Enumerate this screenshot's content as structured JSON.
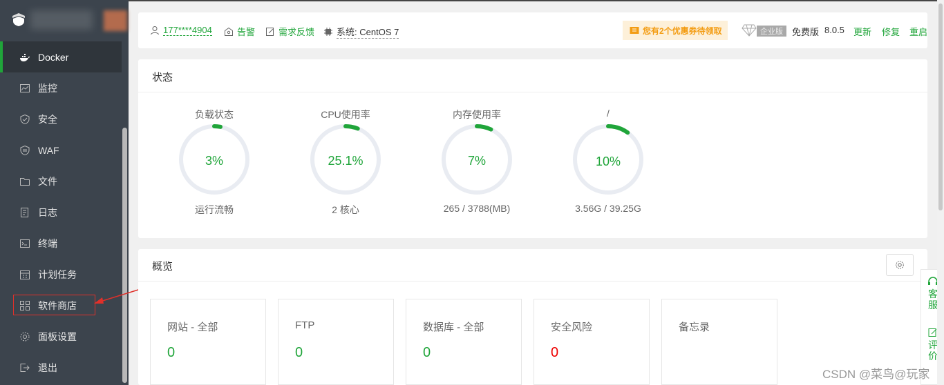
{
  "sidebar": {
    "items": [
      {
        "label": "Docker",
        "icon": "docker-icon",
        "active": true
      },
      {
        "label": "监控",
        "icon": "monitor-icon"
      },
      {
        "label": "安全",
        "icon": "shield-icon"
      },
      {
        "label": "WAF",
        "icon": "waf-shield-icon"
      },
      {
        "label": "文件",
        "icon": "folder-icon"
      },
      {
        "label": "日志",
        "icon": "log-icon"
      },
      {
        "label": "终端",
        "icon": "terminal-icon"
      },
      {
        "label": "计划任务",
        "icon": "calendar-icon"
      },
      {
        "label": "软件商店",
        "icon": "grid-icon"
      },
      {
        "label": "面板设置",
        "icon": "gear-icon"
      },
      {
        "label": "退出",
        "icon": "logout-icon"
      }
    ]
  },
  "header": {
    "user": "177****4904",
    "alert": "告警",
    "feedback": "需求反馈",
    "system_label": "系统:",
    "system_value": "CentOS 7",
    "coupon": "您有2个优惠券待领取",
    "enterprise": "企业版",
    "free": "免费版",
    "version": "8.0.5",
    "update": "更新",
    "repair": "修复",
    "restart": "重启"
  },
  "status": {
    "title": "状态",
    "gauges": [
      {
        "label": "负载状态",
        "value": "3%",
        "sub": "运行流畅",
        "pct": 3
      },
      {
        "label": "CPU使用率",
        "value": "25.1%",
        "sub": "2 核心",
        "pct": 6
      },
      {
        "label": "内存使用率",
        "value": "7%",
        "sub": "265 / 3788(MB)",
        "pct": 7
      },
      {
        "label": "/",
        "value": "10%",
        "sub": "3.56G / 39.25G",
        "pct": 10
      }
    ]
  },
  "overview": {
    "title": "概览",
    "boxes": [
      {
        "title": "网站 - 全部",
        "value": "0"
      },
      {
        "title": "FTP",
        "value": "0"
      },
      {
        "title": "数据库 - 全部",
        "value": "0"
      },
      {
        "title": "安全风险",
        "value": "0"
      },
      {
        "title": "备忘录",
        "value": ""
      }
    ]
  },
  "float_side": {
    "service": "客服",
    "review": "评价"
  },
  "watermark": "CSDN @菜鸟@玩家",
  "colors": {
    "accent": "#20a53a",
    "sidebar": "#3c444d",
    "danger": "#e00000",
    "coupon": "#f39c12"
  }
}
